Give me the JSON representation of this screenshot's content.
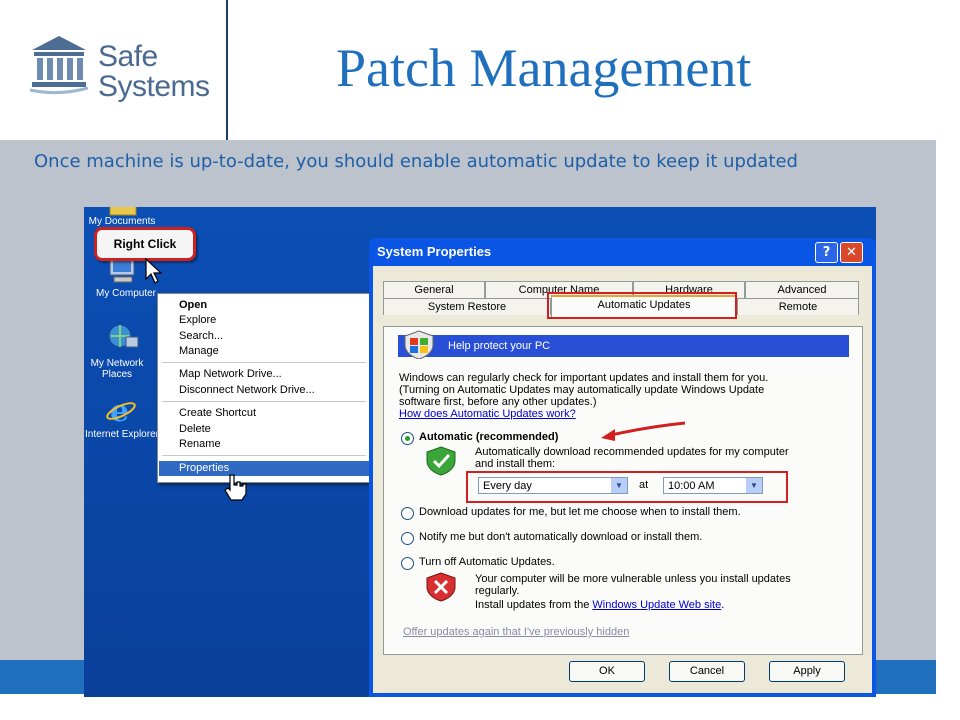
{
  "header": {
    "logo_text": [
      "Safe",
      "Systems"
    ],
    "title": "Patch Management",
    "subtitle": "Once machine is up-to-date, you should enable automatic update to keep it updated"
  },
  "desktop": {
    "icons": [
      {
        "label": "My Documents",
        "icon": "folder-icon"
      },
      {
        "label": "My Computer",
        "icon": "computer-icon"
      },
      {
        "label": "My Network Places",
        "icon": "network-icon"
      },
      {
        "label": "Internet Explorer",
        "icon": "ie-icon"
      }
    ],
    "callout": "Right Click"
  },
  "context_menu": {
    "items": [
      "Open",
      "Explore",
      "Search...",
      "Manage",
      "Map Network Drive...",
      "Disconnect Network Drive...",
      "Create Shortcut",
      "Delete",
      "Rename",
      "Properties"
    ],
    "selected": "Properties"
  },
  "dialog": {
    "title": "System Properties",
    "help_btn": "?",
    "close_btn": "✕",
    "tabs_row1": [
      "General",
      "Computer Name",
      "Hardware",
      "Advanced"
    ],
    "tabs_row2": [
      "System Restore",
      "Automatic Updates",
      "Remote"
    ],
    "active_tab": "Automatic Updates",
    "help_bar": "Help protect your PC",
    "intro": [
      "Windows can regularly check for important updates and install them for you.",
      "(Turning on Automatic Updates may automatically update Windows Update",
      "software first, before any other updates.)"
    ],
    "how_link": "How does Automatic Updates work?",
    "options": {
      "automatic": "Automatic (recommended)",
      "automatic_desc": [
        "Automatically download recommended updates for my computer",
        "and install them:"
      ],
      "frequency": "Every day",
      "at": "at",
      "time": "10:00 AM",
      "download": "Download updates for me, but let me choose when to install them.",
      "notify": "Notify me but don't automatically download or install them.",
      "off": "Turn off Automatic Updates.",
      "off_desc": [
        "Your computer will be more vulnerable unless you install updates",
        "regularly."
      ],
      "install_from": "Install updates from the",
      "web_link": "Windows Update Web site",
      "period": "."
    },
    "offer_link": "Offer updates again that I've previously hidden",
    "buttons": {
      "ok": "OK",
      "cancel": "Cancel",
      "apply": "Apply"
    }
  },
  "colors": {
    "accent": "#1f6fbd",
    "xp_blue": "#0a55e3",
    "highlight_red": "#d02020"
  }
}
